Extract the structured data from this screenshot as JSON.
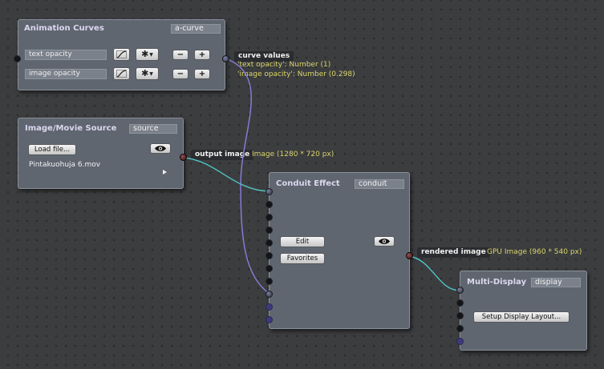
{
  "colors": {
    "background": "#3c3d3f",
    "node": "#5f6670",
    "title": "#dcd7ef",
    "value_text": "#d9d46a",
    "wire_cyan": "#4fc3c3",
    "wire_purple": "#9080e0"
  },
  "nodes": {
    "animation_curves": {
      "title": "Animation Curves",
      "name": "a-curve",
      "params": [
        {
          "label": "text opacity",
          "curve_icon": "curve-icon",
          "gear_icon": "gear-icon",
          "minus": "−",
          "plus": "+"
        },
        {
          "label": "image opacity",
          "curve_icon": "curve-icon",
          "gear_icon": "gear-icon",
          "minus": "−",
          "plus": "+"
        }
      ],
      "output": {
        "label": "curve values",
        "values": [
          "'text opacity': Number (1)",
          "'image opacity': Number (0.298)"
        ]
      }
    },
    "image_source": {
      "title": "Image/Movie Source",
      "name": "source",
      "load_button": "Load file...",
      "file_name": "Pintakuohuja 6.mov",
      "eye_icon": "eye-icon",
      "play_icon": "play-triangle-icon",
      "output": {
        "label": "output image",
        "value": "Image (1280 * 720 px)"
      }
    },
    "conduit_effect": {
      "title": "Conduit Effect",
      "name": "conduit",
      "edit_button": "Edit",
      "favorites_button": "Favorites",
      "eye_icon": "eye-icon",
      "output": {
        "label": "rendered image",
        "value": "GPU Image (960 * 540 px)"
      }
    },
    "multi_display": {
      "title": "Multi-Display",
      "name": "display",
      "setup_button": "Setup Display Layout..."
    }
  }
}
